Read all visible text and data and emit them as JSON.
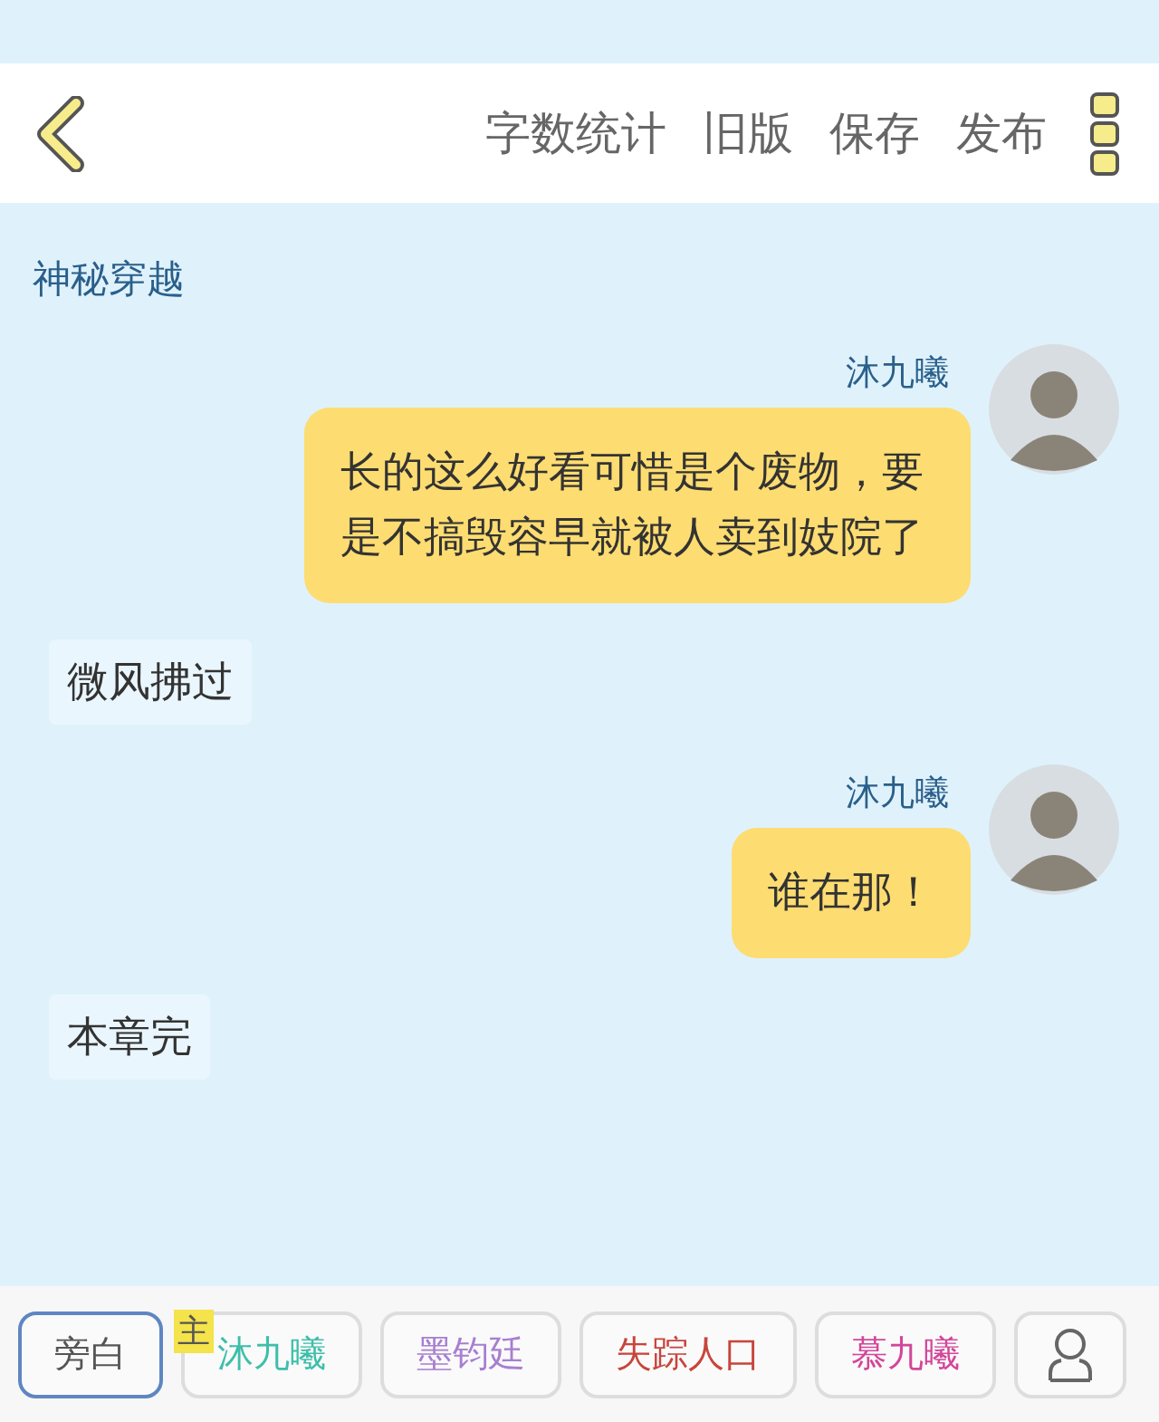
{
  "toolbar": {
    "actions": [
      "字数统计",
      "旧版",
      "保存",
      "发布"
    ]
  },
  "chapter_title": "神秘穿越",
  "messages": [
    {
      "kind": "dialogue",
      "speaker": "沐九曦",
      "text": "长的这么好看可惜是个废物，要是不搞毁容早就被人卖到妓院了"
    },
    {
      "kind": "narration",
      "text": "微风拂过"
    },
    {
      "kind": "dialogue",
      "speaker": "沐九曦",
      "text": "谁在那！"
    },
    {
      "kind": "narration",
      "text": "本章完"
    }
  ],
  "roles": [
    {
      "name": "旁白",
      "selected": true,
      "color": "#555555"
    },
    {
      "name": "沐九曦",
      "selected": false,
      "color": "#3dbfaa",
      "badge": "主"
    },
    {
      "name": "墨钧廷",
      "selected": false,
      "color": "#a77fd0"
    },
    {
      "name": "失踪人口",
      "selected": false,
      "color": "#c8453c"
    },
    {
      "name": "慕九曦",
      "selected": false,
      "color": "#d2479a"
    }
  ]
}
